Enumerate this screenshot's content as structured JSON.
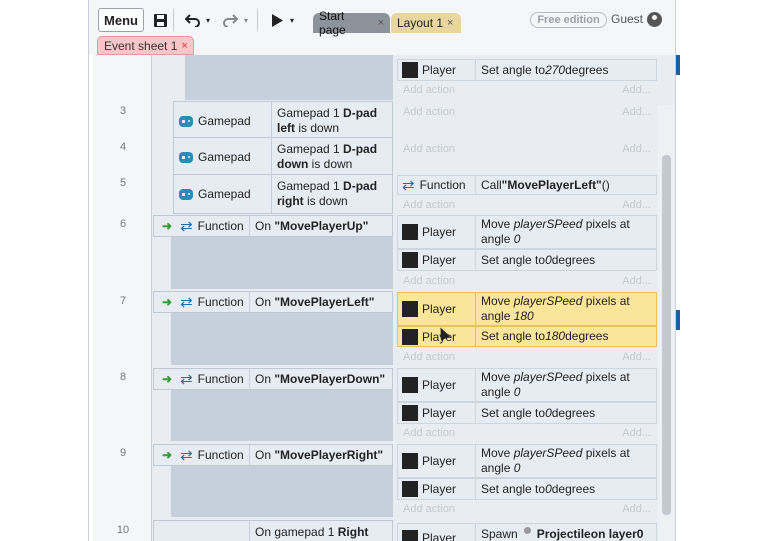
{
  "toolbar": {
    "menu_label": "Menu",
    "tabs": [
      {
        "label": "Start page"
      },
      {
        "label": "Layout 1"
      }
    ],
    "free_edition_label": "Free edition",
    "user_label": "Guest",
    "sheet_tab_label": "Event sheet 1",
    "close_glyph": "×"
  },
  "events": {
    "partial_top": {
      "action_object": "Player",
      "action_text_prefix": "Set angle to ",
      "action_value": "270",
      "action_text_suffix": " degrees"
    },
    "add_action": "Add action",
    "add_more": "Add...",
    "ev3": {
      "num": "3",
      "object": "Gamepad",
      "line1_prefix": "Gamepad 1 ",
      "line1_bold": "D-pad",
      "line2_bold": "left",
      "line2_rest": " is down"
    },
    "ev4": {
      "num": "4",
      "object": "Gamepad",
      "line1_prefix": "Gamepad 1 ",
      "line1_bold": "D-pad",
      "line2_bold": "down",
      "line2_rest": " is down"
    },
    "ev5": {
      "num": "5",
      "object": "Gamepad",
      "line1_prefix": "Gamepad 1 ",
      "line1_bold": "D-pad",
      "line2_bold": "right",
      "line2_rest": " is down",
      "action_object": "Function",
      "action_prefix": "Call ",
      "action_bold": "\"MovePlayerLeft\"",
      "action_suffix": " ()"
    },
    "ev6": {
      "num": "6",
      "object": "Function",
      "on": "On ",
      "name": "\"MovePlayerUp\"",
      "move_prefix": "Move ",
      "speed": "playerSPeed",
      "move_mid": " pixels at",
      "angle_word": "angle ",
      "move_angle": "0",
      "set_prefix": "Set angle to ",
      "set_value": "0",
      "set_suffix": " degrees",
      "obj": "Player"
    },
    "ev7": {
      "num": "7",
      "object": "Function",
      "on": "On ",
      "name": "\"MovePlayerLeft\"",
      "move_prefix": "Move ",
      "speed": "playerSPeed",
      "move_mid": " pixels at",
      "angle_word": "angle ",
      "move_angle": "180",
      "set_prefix": "Set angle to ",
      "set_value": "180",
      "set_suffix": " degrees",
      "obj": "Player"
    },
    "ev8": {
      "num": "8",
      "object": "Function",
      "on": "On ",
      "name": "\"MovePlayerDown\"",
      "move_prefix": "Move ",
      "speed": "playerSPeed",
      "move_mid": " pixels at",
      "angle_word": "angle ",
      "move_angle": "0",
      "set_prefix": "Set angle to ",
      "set_value": "0",
      "set_suffix": " degrees",
      "obj": "Player"
    },
    "ev9": {
      "num": "9",
      "object": "Function",
      "on": "On ",
      "name": "\"MovePlayerRight\"",
      "move_prefix": "Move ",
      "speed": "playerSPeed",
      "move_mid": " pixels at",
      "angle_word": "angle ",
      "move_angle": "0",
      "set_prefix": "Set angle to ",
      "set_value": "0",
      "set_suffix": " degrees",
      "obj": "Player"
    },
    "ev10": {
      "num": "10",
      "cond_prefix": "On gamepad 1 ",
      "cond_bold": "Right",
      "action_object": "Player",
      "action_prefix": "Spawn",
      "action_bold": "Projectile",
      "action_suffix": " on layer ",
      "action_layer": "0"
    }
  },
  "colors": {
    "highlight": "#fbe59a",
    "function_icon": "#1d6fae",
    "gamepad_icon": "#2b8cb8",
    "sheet_tab": "#f8c5c8"
  },
  "icons": [
    "save-icon",
    "undo-icon",
    "redo-icon",
    "play-icon",
    "user-icon",
    "function-icon",
    "gamepad-icon",
    "green-arrow-icon"
  ]
}
